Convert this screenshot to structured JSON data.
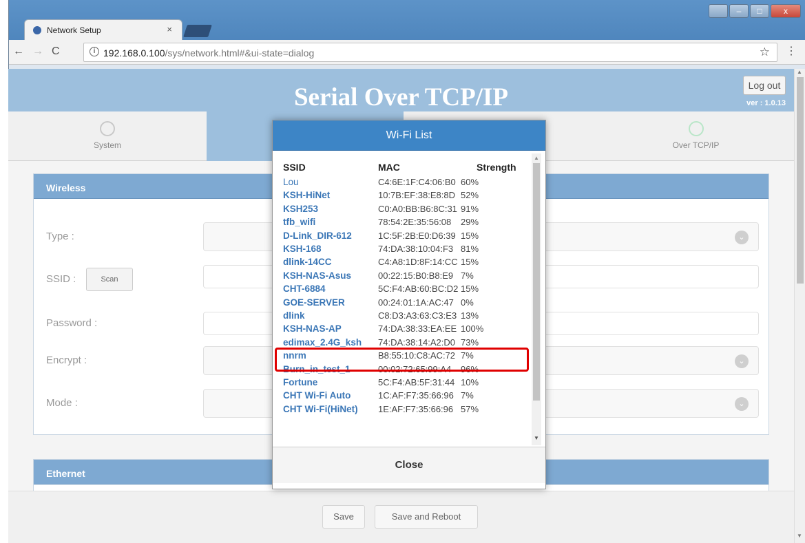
{
  "browser": {
    "tab_title": "Network Setup",
    "tab_close": "×",
    "url_host": "192.168.0.100",
    "url_path": "/sys/network.html#&ui-state=dialog",
    "win_min": "–",
    "win_max": "□",
    "win_close": "x"
  },
  "header": {
    "title": "Serial Over TCP/IP",
    "logout_label": "Log out",
    "version": "ver : 1.0.13"
  },
  "nav": {
    "tabs": [
      {
        "label": "System"
      },
      {
        "label": "Over TCP/IP"
      }
    ]
  },
  "wireless": {
    "heading": "Wireless",
    "type_label": "Type :",
    "ssid_label": "SSID :",
    "scan_label": "Scan",
    "password_label": "Password :",
    "encrypt_label": "Encrypt :",
    "mode_label": "Mode :"
  },
  "ethernet": {
    "heading": "Ethernet"
  },
  "footer": {
    "save_label": "Save",
    "save_reboot_label": "Save and Reboot"
  },
  "wifi_dialog": {
    "title": "Wi-Fi List",
    "col_ssid": "SSID",
    "col_mac": "MAC",
    "col_strength": "Strength",
    "close_label": "Close",
    "networks": [
      {
        "ssid": "Lou",
        "mac": "C4:6E:1F:C4:06:B0",
        "strength": "60%"
      },
      {
        "ssid": "KSH-HiNet",
        "mac": "10:7B:EF:38:E8:8D",
        "strength": "52%"
      },
      {
        "ssid": "KSH253",
        "mac": "C0:A0:BB:B6:8C:31",
        "strength": "91%"
      },
      {
        "ssid": "tfb_wifi",
        "mac": "78:54:2E:35:56:08",
        "strength": "29%"
      },
      {
        "ssid": "D-Link_DIR-612",
        "mac": "1C:5F:2B:E0:D6:39",
        "strength": "15%"
      },
      {
        "ssid": "KSH-168",
        "mac": "74:DA:38:10:04:F3",
        "strength": "81%"
      },
      {
        "ssid": "dlink-14CC",
        "mac": "C4:A8:1D:8F:14:CC",
        "strength": "15%"
      },
      {
        "ssid": "KSH-NAS-Asus",
        "mac": "00:22:15:B0:B8:E9",
        "strength": "7%"
      },
      {
        "ssid": "CHT-6884",
        "mac": "5C:F4:AB:60:BC:D2",
        "strength": "15%"
      },
      {
        "ssid": "GOE-SERVER",
        "mac": "00:24:01:1A:AC:47",
        "strength": "0%"
      },
      {
        "ssid": "dlink",
        "mac": "C8:D3:A3:63:C3:E3",
        "strength": "13%"
      },
      {
        "ssid": "KSH-NAS-AP",
        "mac": "74:DA:38:33:EA:EE",
        "strength": "100%"
      },
      {
        "ssid": "edimax_2.4G_ksh",
        "mac": "74:DA:38:14:A2:D0",
        "strength": "73%"
      },
      {
        "ssid": "nnrm",
        "mac": "B8:55:10:C8:AC:72",
        "strength": "7%"
      },
      {
        "ssid": "Burn_in_test_1",
        "mac": "00:02:72:65:99:A4",
        "strength": "96%"
      },
      {
        "ssid": "Fortune",
        "mac": "5C:F4:AB:5F:31:44",
        "strength": "10%"
      },
      {
        "ssid": "CHT Wi-Fi Auto",
        "mac": "1C:AF:F7:35:66:96",
        "strength": "7%"
      },
      {
        "ssid": "CHT Wi-Fi(HiNet)",
        "mac": "1E:AF:F7:35:66:96",
        "strength": "57%"
      }
    ]
  },
  "colors": {
    "header_bg": "#9dbfdd",
    "dialog_header": "#3d85c6",
    "link_blue": "#3a76b6",
    "highlight_red": "#e00000"
  }
}
